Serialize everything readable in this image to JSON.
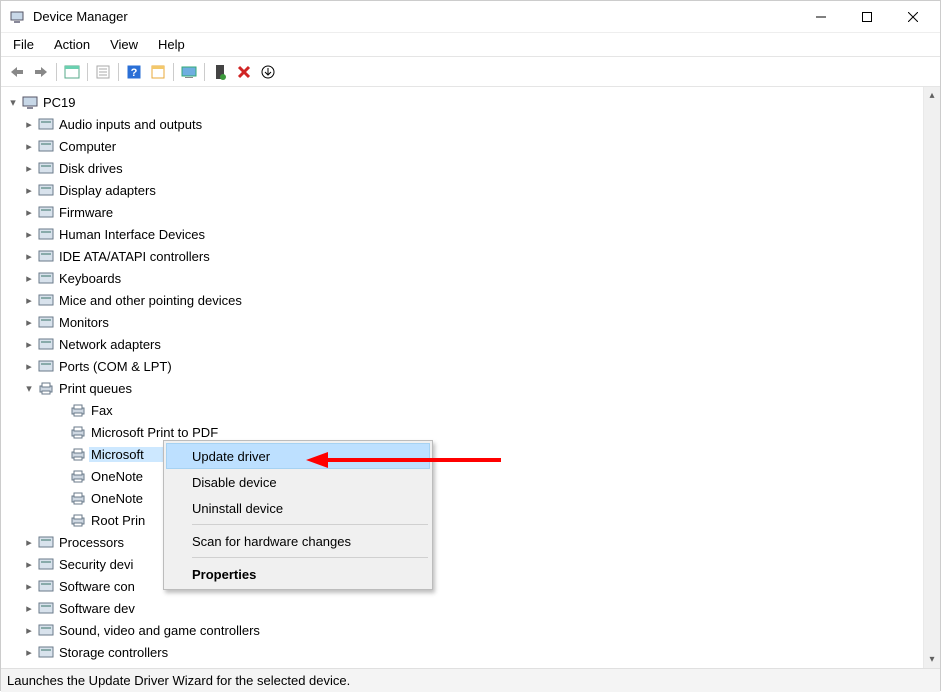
{
  "window": {
    "title": "Device Manager"
  },
  "menus": {
    "file": "File",
    "action": "Action",
    "view": "View",
    "help": "Help"
  },
  "toolbar_icons": [
    "back-arrow-icon",
    "forward-arrow-icon",
    "show-hidden-icon",
    "properties-icon",
    "help-icon",
    "detail-icon",
    "scan-icon",
    "update-driver-icon",
    "uninstall-icon",
    "arrow-down-icon"
  ],
  "tree": {
    "root": "PC19",
    "categories": [
      {
        "label": "Audio inputs and outputs",
        "expandable": true,
        "icon": "audio-icon"
      },
      {
        "label": "Computer",
        "expandable": true,
        "icon": "computer-icon"
      },
      {
        "label": "Disk drives",
        "expandable": true,
        "icon": "disk-icon"
      },
      {
        "label": "Display adapters",
        "expandable": true,
        "icon": "display-icon"
      },
      {
        "label": "Firmware",
        "expandable": true,
        "icon": "firmware-icon"
      },
      {
        "label": "Human Interface Devices",
        "expandable": true,
        "icon": "hid-icon"
      },
      {
        "label": "IDE ATA/ATAPI controllers",
        "expandable": true,
        "icon": "ide-icon"
      },
      {
        "label": "Keyboards",
        "expandable": true,
        "icon": "keyboard-icon"
      },
      {
        "label": "Mice and other pointing devices",
        "expandable": true,
        "icon": "mouse-icon"
      },
      {
        "label": "Monitors",
        "expandable": true,
        "icon": "monitor-icon"
      },
      {
        "label": "Network adapters",
        "expandable": true,
        "icon": "network-icon"
      },
      {
        "label": "Ports (COM & LPT)",
        "expandable": true,
        "icon": "ports-icon"
      },
      {
        "label": "Print queues",
        "expandable": true,
        "expanded": true,
        "icon": "printer-icon",
        "children": [
          {
            "label": "Fax",
            "icon": "printer-icon"
          },
          {
            "label": "Microsoft Print to PDF",
            "icon": "printer-icon"
          },
          {
            "label": "Microsoft",
            "icon": "printer-icon",
            "selected": true,
            "truncated_after_context": true
          },
          {
            "label": "OneNote",
            "icon": "printer-icon"
          },
          {
            "label": "OneNote",
            "icon": "printer-icon"
          },
          {
            "label": "Root Prin",
            "icon": "printer-icon"
          }
        ]
      },
      {
        "label": "Processors",
        "expandable": true,
        "icon": "processor-icon"
      },
      {
        "label": "Security devi",
        "expandable": true,
        "icon": "security-icon"
      },
      {
        "label": "Software con",
        "expandable": true,
        "icon": "software-icon"
      },
      {
        "label": "Software dev",
        "expandable": true,
        "icon": "software-icon"
      },
      {
        "label": "Sound, video and game controllers",
        "expandable": true,
        "icon": "sound-icon"
      },
      {
        "label": "Storage controllers",
        "expandable": true,
        "icon": "storage-icon"
      }
    ]
  },
  "context_menu": {
    "items": [
      {
        "label": "Update driver",
        "highlighted": true
      },
      {
        "label": "Disable device"
      },
      {
        "label": "Uninstall device"
      },
      {
        "separator": true
      },
      {
        "label": "Scan for hardware changes"
      },
      {
        "separator": true
      },
      {
        "label": "Properties",
        "bold": true
      }
    ]
  },
  "status_text": "Launches the Update Driver Wizard for the selected device.",
  "annotation": {
    "type": "red-arrow-left",
    "target": "context-menu-update-driver"
  }
}
